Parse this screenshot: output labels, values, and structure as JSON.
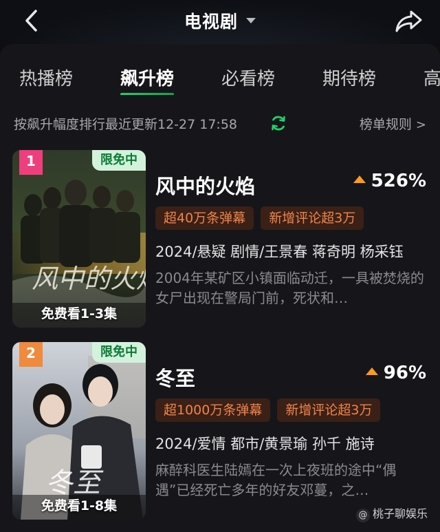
{
  "header": {
    "title": "电视剧",
    "back_icon": "chevron-left-icon",
    "share_icon": "share-arrow-icon"
  },
  "tabs": [
    {
      "label": "热播榜",
      "active": false
    },
    {
      "label": "飙升榜",
      "active": true
    },
    {
      "label": "必看榜",
      "active": false
    },
    {
      "label": "期待榜",
      "active": false
    },
    {
      "label": "高",
      "active": false
    }
  ],
  "subbar": {
    "description": "按飙升幅度排行最近更新12-27 17:58",
    "rules_label": "榜单规则",
    "rules_chevron": ">",
    "accent_color": "#1fd26a"
  },
  "items": [
    {
      "rank": "1",
      "free_badge": "限免中",
      "free_watch": "免费看1-3集",
      "title": "风中的火焰",
      "trend": "526%",
      "tags": [
        "超40万条弹幕",
        "新增评论超3万"
      ],
      "meta": "2024/悬疑 剧情/王景春 蒋奇明 杨采钰",
      "description": "2004年某矿区小镇面临动迁，一具被焚烧的女尸出现在警局门前，死状和…"
    },
    {
      "rank": "2",
      "free_badge": "限免中",
      "free_watch": "免费看1-8集",
      "title": "冬至",
      "trend": "96%",
      "tags": [
        "超1000万条弹幕",
        "新增评论超3万"
      ],
      "meta": "2024/爱情 都市/黄景瑜 孙千 施诗",
      "description": "麻醉科医生陆嫣在一次上夜班的途中“偶遇”已经死亡多年的好友邓蔓，之…"
    }
  ],
  "watermark": {
    "symbol": "@",
    "text": "桃子聊娱乐"
  }
}
